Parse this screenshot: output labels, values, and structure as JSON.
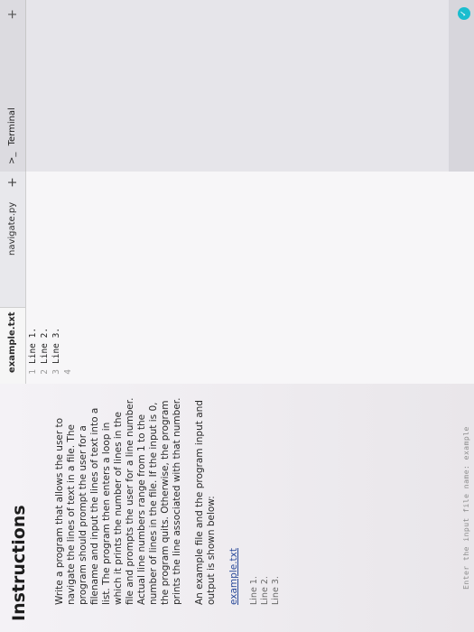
{
  "instructions": {
    "title": "Instructions",
    "paragraphs": [
      "Write a program that allows the user to navigate the lines of text in a file. The program should prompt the user for a filename and input the lines of text into a list. The program then enters a loop in which it prints the number of lines in the file and prompts the user for a line number. Actual line numbers range from 1 to the number of lines in the file. If the input is 0, the program quits. Otherwise, the program prints the line associated with that number.",
      "An example file and the program input and output is shown below:"
    ],
    "example_file_label": "example.txt",
    "example_lines": [
      "Line 1.",
      "Line 2.",
      "Line 3."
    ],
    "hint": "Enter the input file name: example"
  },
  "editor": {
    "tabs": [
      "example.txt",
      "navigate.py"
    ],
    "add_tab": "+",
    "lines": [
      {
        "num": "1",
        "text": "Line 1."
      },
      {
        "num": "2",
        "text": "Line 2."
      },
      {
        "num": "3",
        "text": "Line 3."
      },
      {
        "num": "4",
        "text": ""
      }
    ]
  },
  "terminal": {
    "icon": ">_",
    "label": "Terminal",
    "plus": "+"
  },
  "colors": {
    "instructions_bg": "#f4f2f6",
    "editor_bg": "#f7f6f8",
    "terminal_bg": "#e6e5ea",
    "status_icon": "#1bbdcf"
  }
}
